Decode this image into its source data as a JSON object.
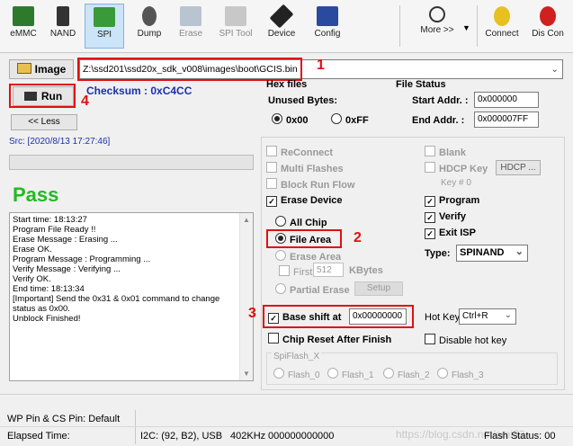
{
  "toolbar": {
    "items": [
      {
        "label": "eMMC"
      },
      {
        "label": "NAND"
      },
      {
        "label": "SPI"
      },
      {
        "label": "Dump"
      },
      {
        "label": "Erase"
      },
      {
        "label": "SPI Tool"
      },
      {
        "label": "Device"
      },
      {
        "label": "Config"
      },
      {
        "label": "More >>"
      },
      {
        "label": "Connect"
      },
      {
        "label": "Dis Con"
      }
    ]
  },
  "image": {
    "button_label": "Image",
    "path": "Z:\\ssd201\\ssd20x_sdk_v008\\images\\boot\\GCIS.bin"
  },
  "run": {
    "label": "Run",
    "checksum": "Checksum : 0xC4CC",
    "less_label": "<< Less"
  },
  "src_text": "Src: [2020/8/13 17:27:46]",
  "result": "Pass",
  "log_lines": [
    "Start time: 18:13:27",
    "Program File Ready !!",
    "Erase Message : Erasing ...",
    "Erase OK.",
    "Program Message : Programming ...",
    "Verify Message : Verifying ...",
    "Verify OK.",
    "End time: 18:13:34",
    "[Important] Send the 0x31 & 0x01 command to change",
    "status as 0x00.",
    "Unblock Finished!"
  ],
  "hex_files": {
    "title": "Hex files",
    "unused_bytes": "Unused Bytes:",
    "opt_00": "0x00",
    "opt_ff": "0xFF"
  },
  "file_status": {
    "title": "File Status",
    "start_label": "Start Addr. :",
    "start_value": "0x000000",
    "end_label": "End Addr. :",
    "end_value": "0x000007FF"
  },
  "options": {
    "reconnect": "ReConnect",
    "multi_flashes": "Multi Flashes",
    "block_run_flow": "Block Run Flow",
    "erase_device": "Erase Device",
    "all_chip": "All Chip",
    "file_area": "File Area",
    "erase_area": "Erase Area",
    "first": "First",
    "first_value": "512",
    "kbytes": "KBytes",
    "partial_erase": "Partial Erase",
    "setup": "Setup",
    "blank": "Blank",
    "hdcp_key": "HDCP Key",
    "hdcp_btn": "HDCP ...",
    "key_num": "Key # 0",
    "program": "Program",
    "verify": "Verify",
    "exit_isp": "Exit ISP",
    "type_label": "Type:",
    "type_value": "SPINAND",
    "base_shift": "Base shift at",
    "base_shift_value": "0x00000000",
    "hot_key_label": "Hot Key",
    "hot_key_value": "Ctrl+R",
    "chip_reset": "Chip Reset After Finish",
    "disable_hot_key": "Disable hot key",
    "spiflash_title": "SpiFlash_X",
    "flash_0": "Flash_0",
    "flash_1": "Flash_1",
    "flash_2": "Flash_2",
    "flash_3": "Flash_3"
  },
  "annotations": {
    "n1": "1",
    "n2": "2",
    "n3": "3",
    "n4": "4"
  },
  "status": {
    "wp_pin": "WP Pin & CS Pin: Default",
    "elapsed": "Elapsed Time:",
    "i2c": "I2C: (92, B2), USB",
    "freq": "402KHz",
    "addr": "000000000000",
    "flash_status": "Flash Status: 00",
    "watermark": "https://blog.csdn.net/ami82"
  },
  "colors": {
    "pass": "#22bb22",
    "annotation": "#e01010",
    "checksum": "#1a2fb0"
  }
}
